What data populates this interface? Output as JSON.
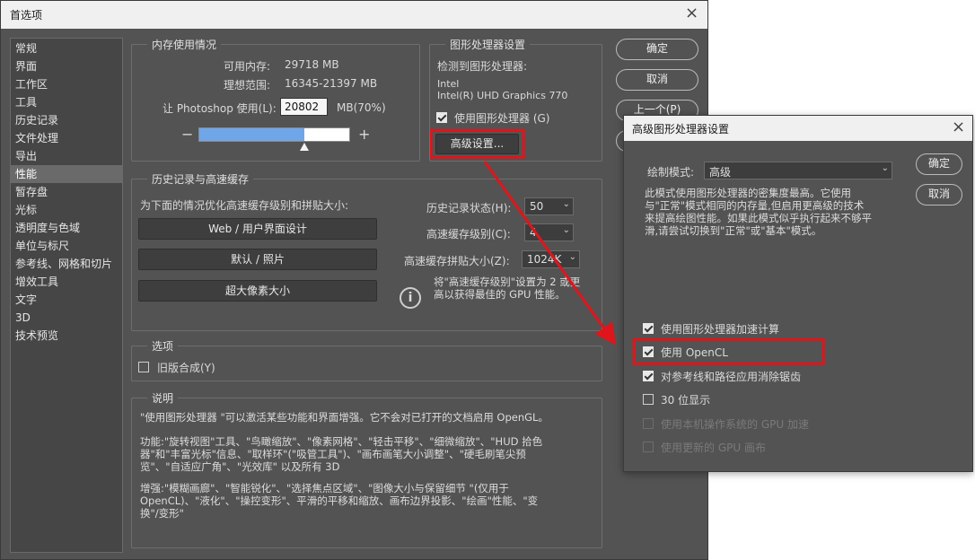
{
  "main_dialog": {
    "title": "首选项",
    "close_glyph": "×"
  },
  "sidebar": {
    "items": [
      "常规",
      "界面",
      "工作区",
      "工具",
      "历史记录",
      "文件处理",
      "导出",
      "性能",
      "暂存盘",
      "光标",
      "透明度与色域",
      "单位与标尺",
      "参考线、网格和切片",
      "增效工具",
      "文字",
      "3D",
      "技术预览"
    ],
    "selected": "性能"
  },
  "memory": {
    "title": "内存使用情况",
    "available_label": "可用内存:",
    "available_value": "29718 MB",
    "ideal_label": "理想范围:",
    "ideal_value": "16345-21397 MB",
    "use_label": "让 Photoshop 使用(L):",
    "use_value": "20802",
    "use_unit": "MB(70%)",
    "minus": "−",
    "plus": "+",
    "slider_fill_fraction": 0.7
  },
  "gpu": {
    "title": "图形处理器设置",
    "detected_label": "检测到图形处理器:",
    "vendor": "Intel",
    "model": "Intel(R) UHD Graphics 770",
    "use_gpu_label": "使用图形处理器 (G)",
    "use_gpu_checked": true,
    "advanced_button": "高级设置..."
  },
  "history_cache": {
    "title": "历史记录与高速缓存",
    "optimize_label": "为下面的情况优化高速缓存级别和拼贴大小:",
    "preset_web": "Web / 用户界面设计",
    "preset_default": "默认 / 照片",
    "preset_huge": "超大像素大小",
    "history_states_label": "历史记录状态(H):",
    "history_states_value": "50",
    "cache_levels_label": "高速缓存级别(C):",
    "cache_levels_value": "4",
    "tile_size_label": "高速缓存拼贴大小(Z):",
    "tile_size_value": "1024K",
    "info_text_1": "将\"高速缓存级别\"设置为 2 或更",
    "info_text_2": "高以获得最佳的 GPU 性能。"
  },
  "options": {
    "title": "选项",
    "legacy_compositing_label": "旧版合成(Y)",
    "legacy_compositing_checked": false
  },
  "description": {
    "title": "说明",
    "p1": "\"使用图形处理器 \"可以激活某些功能和界面增强。它不会对已打开的文档启用 OpenGL。",
    "p2_l1": "功能:\"旋转视图\"工具、\"鸟瞰缩放\"、\"像素网格\"、\"轻击平移\"、\"细微缩放\"、\"HUD 拾色",
    "p2_l2": "器\"和\"丰富光标\"信息、\"取样环\"(\"吸管工具\")、\"画布画笔大小调整\"、\"硬毛刷笔尖预",
    "p2_l3": "览\"、\"自适应广角\"、\"光效库\" 以及所有 3D",
    "p3_l1": "增强:\"模糊画廊\"、\"智能锐化\"、\"选择焦点区域\"、\"图像大小与保留细节 \"(仅用于",
    "p3_l2": "OpenCL)、\"液化\"、\"操控变形\"、平滑的平移和缩放、画布边界投影、\"绘画\"性能、\"变",
    "p3_l3": "换\"/变形\""
  },
  "main_buttons": {
    "ok": "确定",
    "cancel": "取消",
    "prev": "上一个(P)"
  },
  "advanced_dialog": {
    "title": "高级图形处理器设置",
    "close_glyph": "×",
    "draw_mode_label": "绘制模式:",
    "draw_mode_value": "高级",
    "desc_l1": "此模式使用图形处理器的密集度最高。它使用",
    "desc_l2": "与\"正常\"模式相同的内存量,但启用更高级的技术",
    "desc_l3": "来提高绘图性能。如果此模式似乎执行起来不够平",
    "desc_l4": "滑,请尝试切换到\"正常\"或\"基本\"模式。",
    "ok": "确定",
    "cancel": "取消",
    "options": [
      {
        "label": "使用图形处理器加速计算",
        "checked": true,
        "enabled": true
      },
      {
        "label": "使用 OpenCL",
        "checked": true,
        "enabled": true
      },
      {
        "label": "对参考线和路径应用消除锯齿",
        "checked": true,
        "enabled": true
      },
      {
        "label": "30 位显示",
        "checked": false,
        "enabled": true
      },
      {
        "label": "使用本机操作系统的 GPU 加速",
        "checked": false,
        "enabled": false
      },
      {
        "label": "使用更新的 GPU 画布",
        "checked": false,
        "enabled": false
      }
    ]
  },
  "colors": {
    "panel_bg": "#535353",
    "highlight_red": "#e0151b",
    "slider_blue": "#6fa6e8"
  }
}
